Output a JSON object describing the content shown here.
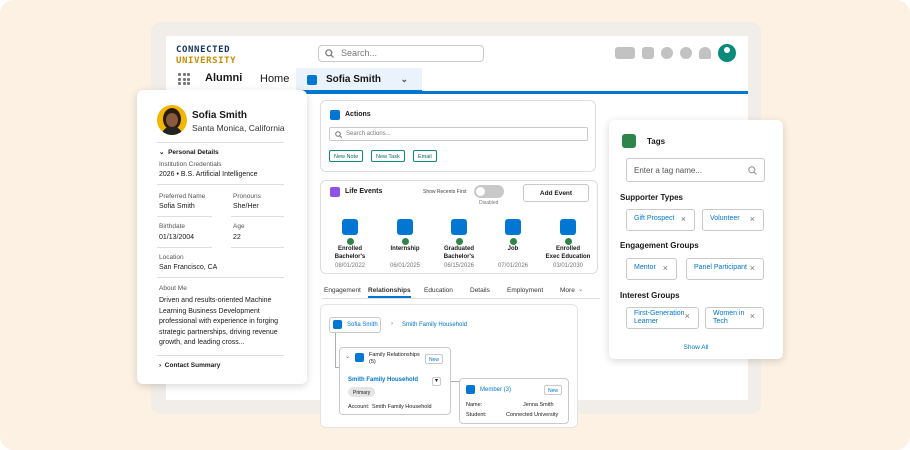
{
  "header": {
    "logo_line1": "CONNECTED",
    "logo_line2": "UNIVERSITY",
    "search_placeholder": "Search..."
  },
  "nav": {
    "app_name": "Alumni",
    "home": "Home",
    "active_tab": "Sofia Smith"
  },
  "profile": {
    "name": "Sofia Smith",
    "location": "Santa Monica, California",
    "section": "Personal Details",
    "credentials_label": "Institution Credentials",
    "credentials_value": "2026 • B.S. Artificial Intelligence",
    "preferred_name_label": "Preferred Name",
    "preferred_name": "Sofia Smith",
    "pronouns_label": "Pronouns",
    "pronouns": "She/Her",
    "birthdate_label": "Birthdate",
    "birthdate": "01/13/2004",
    "age_label": "Age",
    "age": "22",
    "location_label": "Location",
    "location_value": "San Francisco, CA",
    "about_label": "About Me",
    "about": "Driven and results-oriented Machine Learning Business Development professional with experience in forging strategic partnerships, driving revenue growth, and leading cross...",
    "contact_summary": "Contact Summary"
  },
  "actions": {
    "title": "Actions",
    "search_placeholder": "Search actions...",
    "buttons": [
      "New Note",
      "New Task",
      "Email"
    ]
  },
  "life_events": {
    "title": "Life Events",
    "show_recents": "Show Recents First",
    "toggle_state": "Disabled",
    "add_button": "Add Event",
    "events": [
      {
        "title": "Enrolled\nBachelor's",
        "date": "08/01/2022"
      },
      {
        "title": "Internship",
        "date": "06/01/2025"
      },
      {
        "title": "Graduated\nBachelor's",
        "date": "06/15/2026"
      },
      {
        "title": "Job",
        "date": "07/01/2026"
      },
      {
        "title": "Enrolled\nExec Education",
        "date": "03/01/2030"
      }
    ]
  },
  "detail_tabs": [
    "Engagement",
    "Relationships",
    "Education",
    "Details",
    "Employment",
    "More"
  ],
  "relationships": {
    "root": "Sofia Smith",
    "root_link": "Smith Family Household",
    "family_title": "Family Relationships (5)",
    "new_label": "New",
    "household": "Smith Family Household",
    "primary_badge": "Primary",
    "account_label": "Account:",
    "account_value": "Smith Family Household",
    "member_title": "Member (3)",
    "name_label": "Name:",
    "name_value": "Jenna Smith",
    "student_label": "Student:",
    "student_value": "Connected University"
  },
  "tags": {
    "title": "Tags",
    "input_placeholder": "Enter a tag name...",
    "supporter_title": "Supporter Types",
    "supporter": [
      "Gift Prospect",
      "Volunteer"
    ],
    "engagement_title": "Engagement Groups",
    "engagement": [
      "Mentor",
      "Panel Participant"
    ],
    "interest_title": "Interest Groups",
    "interest": [
      "First-Generation\nLearner",
      "Women in\nTech"
    ],
    "show_all": "Show All"
  }
}
